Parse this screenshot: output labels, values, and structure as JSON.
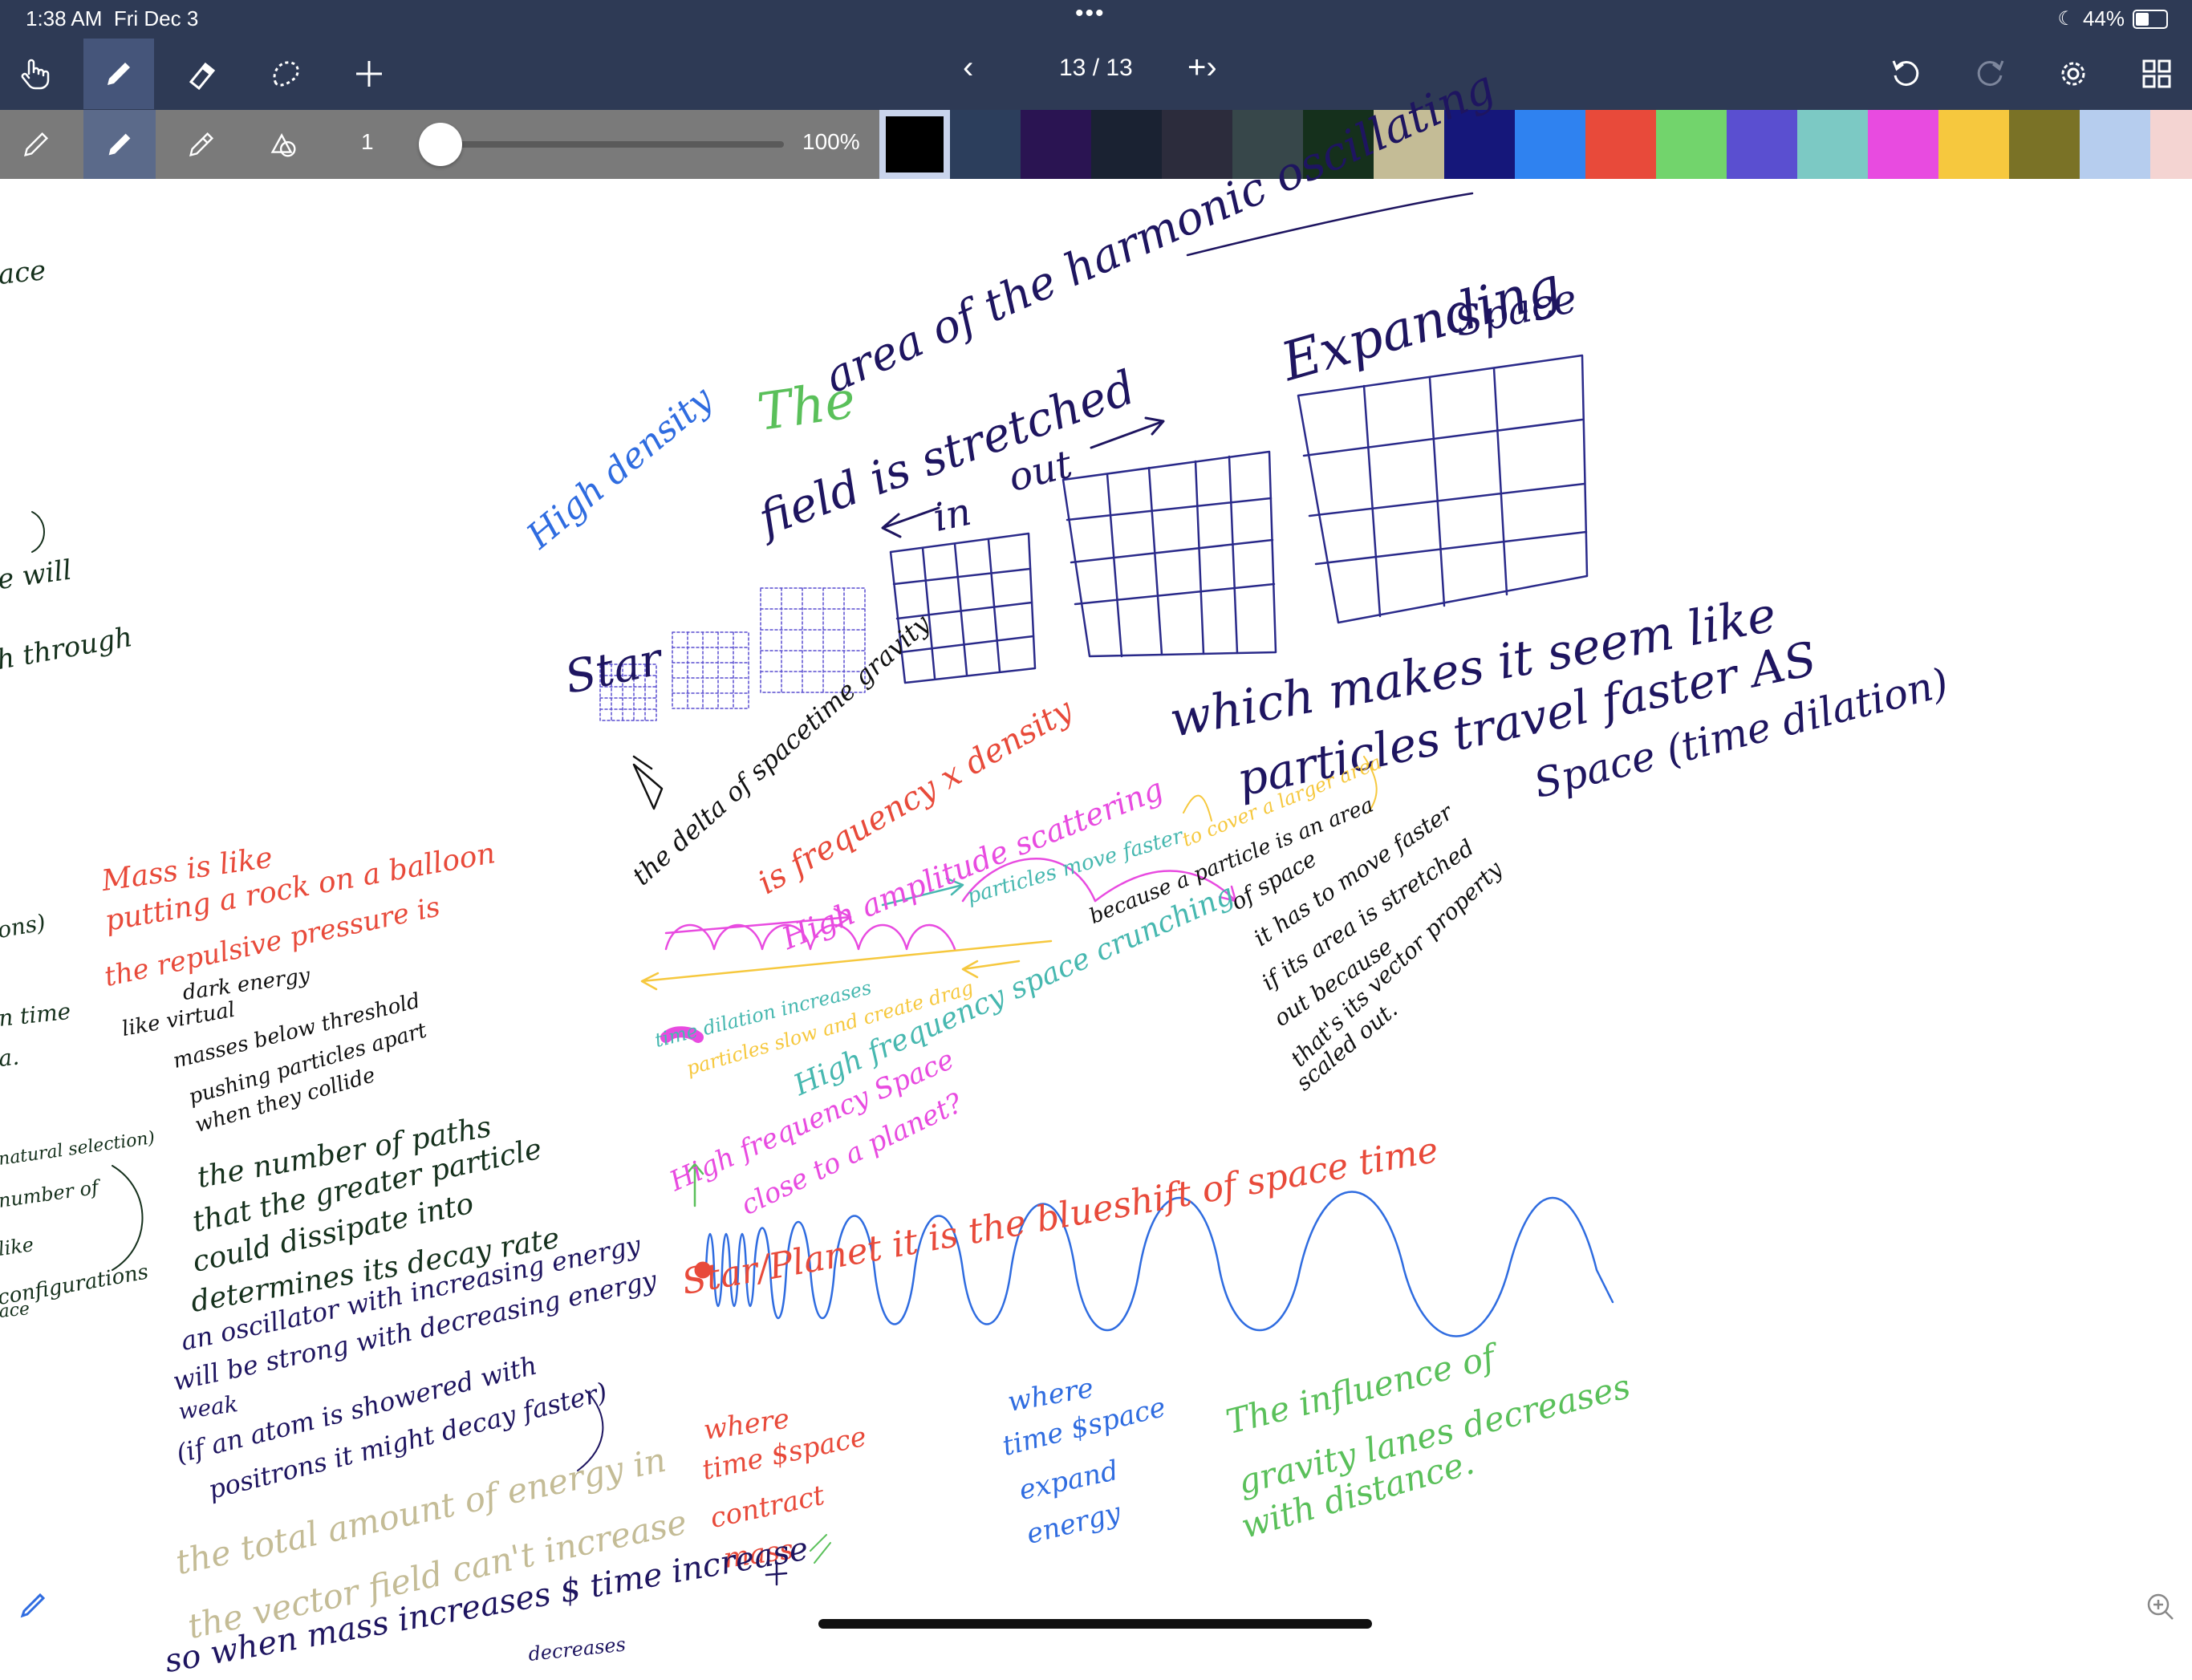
{
  "status": {
    "time": "1:38 AM",
    "date": "Fri Dec 3",
    "battery": "44%",
    "battery_level": 0.44,
    "dots": "•••"
  },
  "toolbar": {
    "tools": [
      {
        "name": "hand-tool",
        "icon": "hand-icon"
      },
      {
        "name": "pen-tool",
        "icon": "pen-icon",
        "active": true
      },
      {
        "name": "eraser-tool",
        "icon": "eraser-icon"
      },
      {
        "name": "lasso-tool",
        "icon": "lasso-icon"
      },
      {
        "name": "add-tool",
        "icon": "plus-icon"
      }
    ],
    "page_indicator": "13 / 13",
    "prev": "‹",
    "next": "+›"
  },
  "subbar": {
    "stroke_size": "1",
    "opacity": "100%",
    "slider_level": 0.0,
    "colors": [
      "#000000",
      "#2c3e5c",
      "#2a1452",
      "#1a2232",
      "#2c2c3c",
      "#37474a",
      "#15301c",
      "#c4bc96",
      "#15177a",
      "#2f82f0",
      "#e84a3a",
      "#72d46c",
      "#5a4fd0",
      "#7cc9c4",
      "#e84be0",
      "#f6c83e",
      "#7a7226",
      "#b6cdee",
      "#f4d4d2"
    ],
    "selected_color": 0
  },
  "canvas": {
    "notes": [
      {
        "id": "n01",
        "text": "The",
        "color": "#5ac05a"
      },
      {
        "id": "n02",
        "text": "area of the harmonic oscillating",
        "color": "#1e1560"
      },
      {
        "id": "n03",
        "text": "field is stretched",
        "color": "#1e1560"
      },
      {
        "id": "n04",
        "text": "Expanding",
        "color": "#1e1560"
      },
      {
        "id": "n05",
        "text": "Space",
        "color": "#1e1560"
      },
      {
        "id": "n06",
        "text": "High density",
        "color": "#2f6ce0"
      },
      {
        "id": "n07",
        "text": "in",
        "color": "#1e1560"
      },
      {
        "id": "n08",
        "text": "out",
        "color": "#1e1560"
      },
      {
        "id": "n09",
        "text": "Star",
        "color": "#1e1560"
      },
      {
        "id": "n10",
        "text": "which makes it seem like",
        "color": "#1e1560"
      },
      {
        "id": "n11",
        "text": "particles travel faster AS",
        "color": "#1e1560"
      },
      {
        "id": "n12",
        "text": "Space (time dilation)",
        "color": "#1e1560"
      },
      {
        "id": "n13",
        "text": "the delta of spacetime gravity",
        "color": "#111111"
      },
      {
        "id": "n14",
        "text": "is frequency x density",
        "color": "#e84a3a"
      },
      {
        "id": "n15",
        "text": "High amplitude scattering",
        "color": "#e84be0"
      },
      {
        "id": "n16",
        "text": "particles move faster",
        "color": "#47b8b0"
      },
      {
        "id": "n17",
        "text": "to cover a larger area",
        "color": "#f6c83e"
      },
      {
        "id": "n18",
        "text": "because a particle is an area",
        "color": "#111111"
      },
      {
        "id": "n19",
        "text": "of space",
        "color": "#111111"
      },
      {
        "id": "n20",
        "text": "it has to move faster",
        "color": "#111111"
      },
      {
        "id": "n21",
        "text": "if its area is stretched",
        "color": "#111111"
      },
      {
        "id": "n22",
        "text": "out because",
        "color": "#111111"
      },
      {
        "id": "n23",
        "text": "that's its vector property",
        "color": "#111111"
      },
      {
        "id": "n24",
        "text": "scaled out.",
        "color": "#111111"
      },
      {
        "id": "n25",
        "text": "time dilation increases",
        "color": "#47b8b0"
      },
      {
        "id": "n26",
        "text": "particles slow and create drag",
        "color": "#f6c83e"
      },
      {
        "id": "n27",
        "text": "High frequency space crunching",
        "color": "#47b8b0"
      },
      {
        "id": "n28",
        "text": "High frequency Space",
        "color": "#e84be0"
      },
      {
        "id": "n29",
        "text": "close to a planet?",
        "color": "#e84be0"
      },
      {
        "id": "n30",
        "text": "Star/Planet it is the blueshift of space time",
        "color": "#e84a3a"
      },
      {
        "id": "n31",
        "text": "where",
        "color": "#e84a3a"
      },
      {
        "id": "n32",
        "text": "time $space",
        "color": "#e84a3a"
      },
      {
        "id": "n33",
        "text": "contract",
        "color": "#e84a3a"
      },
      {
        "id": "n34",
        "text": "mass",
        "color": "#e84a3a"
      },
      {
        "id": "n35",
        "text": "where",
        "color": "#2f6ce0"
      },
      {
        "id": "n36",
        "text": "time $space",
        "color": "#2f6ce0"
      },
      {
        "id": "n37",
        "text": "expand",
        "color": "#2f6ce0"
      },
      {
        "id": "n38",
        "text": "energy",
        "color": "#2f6ce0"
      },
      {
        "id": "n39",
        "text": "The influence of",
        "color": "#5ac05a"
      },
      {
        "id": "n40",
        "text": "gravity lanes decreases",
        "color": "#5ac05a"
      },
      {
        "id": "n41",
        "text": "with distance.",
        "color": "#5ac05a"
      },
      {
        "id": "n42",
        "text": "Mass is like",
        "color": "#e84a3a"
      },
      {
        "id": "n43",
        "text": "putting a rock on a balloon",
        "color": "#e84a3a"
      },
      {
        "id": "n44",
        "text": "the repulsive pressure is",
        "color": "#e84a3a"
      },
      {
        "id": "n45",
        "text": "dark energy",
        "color": "#111111"
      },
      {
        "id": "n46",
        "text": "like virtual",
        "color": "#111111"
      },
      {
        "id": "n47",
        "text": "masses below threshold",
        "color": "#111111"
      },
      {
        "id": "n48",
        "text": "pushing particles apart",
        "color": "#111111"
      },
      {
        "id": "n49",
        "text": "when they collide",
        "color": "#111111"
      },
      {
        "id": "n50",
        "text": "the number of paths",
        "color": "#15301c"
      },
      {
        "id": "n51",
        "text": "that the greater particle",
        "color": "#15301c"
      },
      {
        "id": "n52",
        "text": "could dissipate into",
        "color": "#15301c"
      },
      {
        "id": "n53",
        "text": "determines its decay rate",
        "color": "#15301c"
      },
      {
        "id": "n54",
        "text": "an oscillator with increasing energy",
        "color": "#1e1560"
      },
      {
        "id": "n55",
        "text": "will be strong with decreasing energy",
        "color": "#1e1560"
      },
      {
        "id": "n56",
        "text": "weak",
        "color": "#1e1560"
      },
      {
        "id": "n57",
        "text": "(if an atom is showered with",
        "color": "#1e1560"
      },
      {
        "id": "n58",
        "text": "positrons it might decay faster)",
        "color": "#1e1560"
      },
      {
        "id": "n59",
        "text": "the total amount of energy in",
        "color": "#c4bc96"
      },
      {
        "id": "n60",
        "text": "the vector field can't increase",
        "color": "#c4bc96"
      },
      {
        "id": "n61",
        "text": "so when mass increases $ time increase",
        "color": "#1e1560"
      },
      {
        "id": "n62",
        "text": "decreases",
        "color": "#1e1560"
      },
      {
        "id": "n63",
        "text": "ace",
        "color": "#15301c"
      },
      {
        "id": "n64",
        "text": "e will",
        "color": "#15301c"
      },
      {
        "id": "n65",
        "text": "h through",
        "color": "#15301c"
      },
      {
        "id": "n66",
        "text": "ons)",
        "color": "#15301c"
      },
      {
        "id": "n67",
        "text": "n time",
        "color": "#15301c"
      },
      {
        "id": "n68",
        "text": "a.",
        "color": "#15301c"
      },
      {
        "id": "n69",
        "text": "natural selection)",
        "color": "#15301c"
      },
      {
        "id": "n70",
        "text": "number of",
        "color": "#15301c"
      },
      {
        "id": "n71",
        "text": "like",
        "color": "#15301c"
      },
      {
        "id": "n72",
        "text": "configurations",
        "color": "#15301c"
      },
      {
        "id": "n73",
        "text": "ace",
        "color": "#15301c"
      }
    ]
  }
}
